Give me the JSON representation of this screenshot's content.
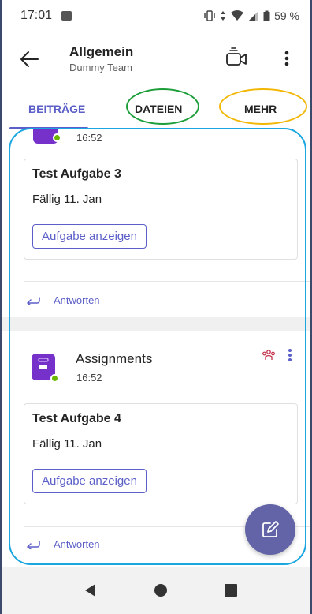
{
  "status_bar": {
    "time": "17:01",
    "battery": "59 %"
  },
  "header": {
    "title": "Allgemein",
    "subtitle": "Dummy Team"
  },
  "tabs": [
    {
      "label": "BEITRÄGE",
      "active": true
    },
    {
      "label": "DATEIEN",
      "active": false
    },
    {
      "label": "MEHR",
      "active": false
    }
  ],
  "posts": [
    {
      "time": "16:52",
      "card": {
        "title": "Test Aufgabe 3",
        "due": "Fällig 11. Jan",
        "button": "Aufgabe anzeigen"
      },
      "reply": "Antworten"
    },
    {
      "author": "Assignments",
      "time": "16:52",
      "card": {
        "title": "Test Aufgabe 4",
        "due": "Fällig 11. Jan",
        "button": "Aufgabe anzeigen"
      },
      "reply": "Antworten"
    }
  ],
  "colors": {
    "accent": "#5b5fc7",
    "fab": "#6264a7",
    "avatar": "#7531c9",
    "presence": "#6bb700",
    "annotation_green": "#1e9e3a",
    "annotation_yellow": "#f2b705",
    "annotation_blue": "#1aa6e0"
  },
  "icons": {
    "back": "arrow-left-icon",
    "video": "video-call-icon",
    "more": "more-vertical-icon",
    "reply": "reply-arrow-icon",
    "team": "team-icon",
    "compose": "compose-icon"
  }
}
